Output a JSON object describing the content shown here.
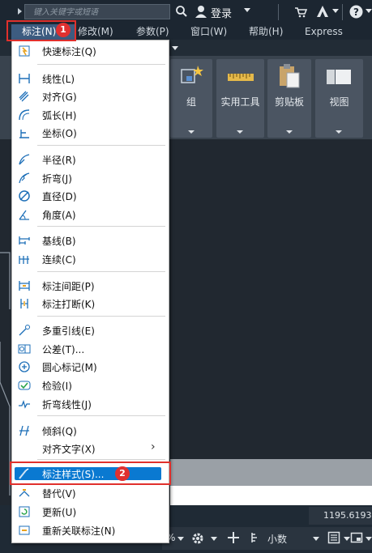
{
  "titlebar": {
    "search_placeholder": "键入关键字或短语",
    "login": "登录"
  },
  "menubar": [
    {
      "label": "标注(N)"
    },
    {
      "label": "修改(M)"
    },
    {
      "label": "参数(P)"
    },
    {
      "label": "窗口(W)"
    },
    {
      "label": "帮助(H)"
    },
    {
      "label": "Express"
    }
  ],
  "ribbon": {
    "buttons": [
      {
        "label": "组"
      },
      {
        "label": "实用工具"
      },
      {
        "label": "剪贴板"
      },
      {
        "label": "视图"
      }
    ]
  },
  "dimension_menu": {
    "items": [
      {
        "label": "快速标注(Q)",
        "icon": "quick-dimension-icon"
      },
      {
        "label": "线性(L)",
        "icon": "linear-dimension-icon"
      },
      {
        "label": "对齐(G)",
        "icon": "aligned-dimension-icon"
      },
      {
        "label": "弧长(H)",
        "icon": "arc-length-icon"
      },
      {
        "label": "坐标(O)",
        "icon": "ordinate-icon"
      },
      {
        "label": "半径(R)",
        "icon": "radius-icon"
      },
      {
        "label": "折弯(J)",
        "icon": "jogged-icon"
      },
      {
        "label": "直径(D)",
        "icon": "diameter-icon"
      },
      {
        "label": "角度(A)",
        "icon": "angular-icon"
      },
      {
        "label": "基线(B)",
        "icon": "baseline-icon"
      },
      {
        "label": "连续(C)",
        "icon": "continue-icon"
      },
      {
        "label": "标注间距(P)",
        "icon": "dimension-space-icon"
      },
      {
        "label": "标注打断(K)",
        "icon": "dimension-break-icon"
      },
      {
        "label": "多重引线(E)",
        "icon": "multileader-icon"
      },
      {
        "label": "公差(T)...",
        "icon": "tolerance-icon"
      },
      {
        "label": "圆心标记(M)",
        "icon": "center-mark-icon"
      },
      {
        "label": "检验(I)",
        "icon": "inspection-icon"
      },
      {
        "label": "折弯线性(J)",
        "icon": "jogged-linear-icon"
      },
      {
        "label": "倾斜(Q)",
        "icon": "oblique-icon"
      },
      {
        "label": "对齐文字(X)",
        "icon": ""
      },
      {
        "label": "标注样式(S)...",
        "icon": "dimension-style-icon"
      },
      {
        "label": "替代(V)",
        "icon": "override-icon"
      },
      {
        "label": "更新(U)",
        "icon": "update-icon"
      },
      {
        "label": "重新关联标注(N)",
        "icon": "reassociate-icon"
      }
    ],
    "submenu_arrow": "›"
  },
  "annotations": {
    "step1": "1",
    "step2": "2"
  },
  "statusbar": {
    "coordinates": "1195.6193,",
    "units": "小数",
    "zoom_suffix": "%"
  },
  "colors": {
    "highlight": "#0a79d1",
    "annotation_red": "#e0302c"
  }
}
